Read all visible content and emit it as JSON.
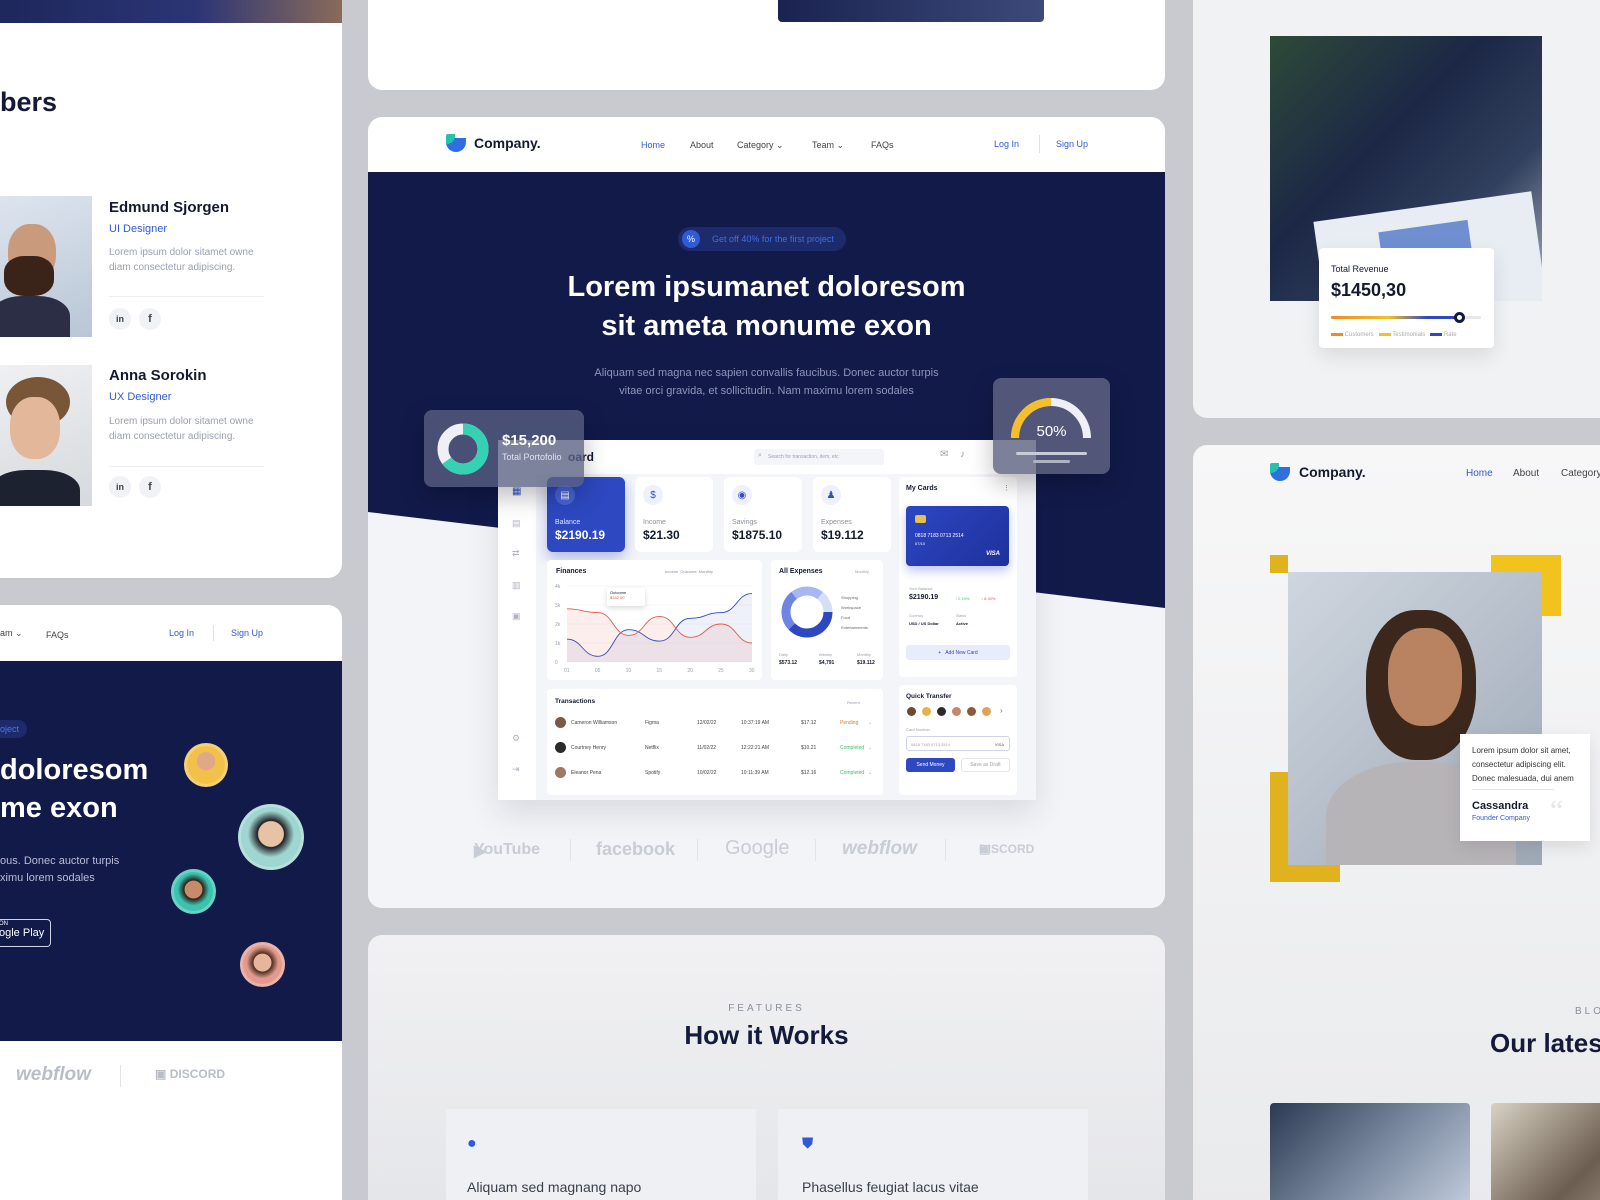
{
  "left": {
    "section_title": "bers",
    "members": [
      {
        "name": "Edmund Sjorgen",
        "role": "UI Designer",
        "bio": "Lorem ipsum dolor sitamet owne diam consectetur adipiscing."
      },
      {
        "name": "Anna Sorokin",
        "role": "UX Designer",
        "bio": "Lorem ipsum dolor sitamet owne diam consectetur adipiscing."
      }
    ],
    "nav": {
      "team_partial": "am",
      "faqs": "FAQs",
      "login": "Log In",
      "signup": "Sign Up"
    },
    "hero": {
      "badge_partial": "oject",
      "line1": "doloresom",
      "line2": "me exon",
      "body1": "ous. Donec auctor turpis",
      "body2": "ximu lorem sodales",
      "store_top": "ON",
      "store_name": "ogle Play"
    },
    "logos": {
      "webflow": "webflow",
      "discord": "DISCORD"
    }
  },
  "main": {
    "brand": "Company.",
    "nav": {
      "home": "Home",
      "about": "About",
      "category": "Category",
      "team": "Team",
      "faqs": "FAQs",
      "login": "Log In",
      "signup": "Sign Up"
    },
    "badge": "Get off 40% for the first project",
    "headline1": "Lorem ipsumanet doloresom",
    "headline2": "sit ameta monume exon",
    "subtext1": "Aliquam sed magna nec sapien convallis faucibus. Donec auctor turpis",
    "subtext2": "vitae orci gravida, et sollicitudin. Nam maximu lorem sodales",
    "portfolio": {
      "value": "$15,200",
      "label": "Total Portofolio",
      "percent": 0.65
    },
    "gauge": {
      "value": "50%",
      "percent": 0.5
    },
    "dashboard": {
      "title": "oard",
      "search_placeholder": "Search for transaction, item, etc",
      "stats": [
        {
          "label": "Balance",
          "value": "$2190.19",
          "icon": "wallet-icon"
        },
        {
          "label": "Income",
          "value": "$21.30",
          "icon": "income-icon"
        },
        {
          "label": "Savings",
          "value": "$1875.10",
          "icon": "piggy-bank-icon"
        },
        {
          "label": "Expenses",
          "value": "$19.112",
          "icon": "expense-icon"
        }
      ],
      "finances": {
        "title": "Finances",
        "legend": [
          "Income",
          "Outcome"
        ],
        "period": "Monthly",
        "tooltip_label": "Outcome",
        "tooltip_value": "$342.00"
      },
      "expenses": {
        "title": "All Expenses",
        "period": "Monthly",
        "legend": [
          "Shopping",
          "Workspace",
          "Food",
          "Entertainments"
        ],
        "daily_label": "Daily",
        "daily": "$573.12",
        "weekly_label": "Weekly",
        "weekly": "$4,791",
        "monthly_label": "Monthly",
        "monthly": "$19.112"
      },
      "cards": {
        "title": "My Cards",
        "card_number": "0818 7183 0713 2514",
        "card_exp": "07/10",
        "card_brand": "VISA",
        "balance_label": "Your Balance",
        "balance": "$2190.19",
        "up": "↑ 2.19%",
        "down": "↓ 8.30%",
        "currency_label": "Currency",
        "currency": "USD / US Dollar",
        "status_label": "Status",
        "status": "Active",
        "add_card": "Add New Card"
      },
      "transactions": {
        "title": "Transactions",
        "filter": "Recent",
        "rows": [
          {
            "name": "Cameron Williamson",
            "company": "Figma",
            "date": "12/02/22",
            "time": "10:37:19 AM",
            "amount": "$17.12",
            "status": "Pending"
          },
          {
            "name": "Courtney Henry",
            "company": "Netflix",
            "date": "11/02/22",
            "time": "12:22:21 AM",
            "amount": "$10.21",
            "status": "Completed"
          },
          {
            "name": "Eleanor Pena",
            "company": "Spotify",
            "date": "10/02/22",
            "time": "10:11:39 AM",
            "amount": "$12.16",
            "status": "Completed"
          }
        ]
      },
      "quick_transfer": {
        "title": "Quick Transfer",
        "card_label": "Card Number",
        "card_value": "0818 7183 0713 2514",
        "card_brand": "VISA",
        "send": "Send Money",
        "draft": "Save as Draft"
      }
    },
    "logos": [
      "YouTube",
      "facebook",
      "Google",
      "webflow",
      "DISCORD"
    ]
  },
  "features": {
    "eyebrow": "FEATURES",
    "title": "How it Works",
    "item1": "Aliquam sed magnang napo",
    "item2": "Phasellus feugiat lacus vitae"
  },
  "right": {
    "revenue": {
      "label": "Total Revenue",
      "value": "$1450,30",
      "legend": [
        "Customers",
        "Testimonials",
        "Rate"
      ],
      "progress": 0.85
    },
    "brand": "Company.",
    "nav": {
      "home": "Home",
      "about": "About",
      "category": "Category"
    },
    "testimonial": {
      "quote": "Lorem ipsum dolor sit amet, consectetur adipiscing elit. Donec malesuada, dui anem",
      "name": "Cassandra",
      "title": "Founder Company"
    },
    "blog_eyebrow": "BLO",
    "blog_title": "Our lates"
  },
  "chart_data": {
    "type": "line",
    "categories": [
      "01",
      "05",
      "10",
      "15",
      "20",
      "25",
      "30"
    ],
    "ylim": [
      0,
      4000
    ],
    "yticks": [
      "4k",
      "3k",
      "2k",
      "1k",
      "0"
    ],
    "series": [
      {
        "name": "Income",
        "values": [
          1200,
          300,
          1700,
          1100,
          2300,
          2600,
          3600
        ]
      },
      {
        "name": "Outcome",
        "values": [
          2800,
          2600,
          1400,
          2400,
          1300,
          2000,
          1000
        ]
      }
    ]
  }
}
